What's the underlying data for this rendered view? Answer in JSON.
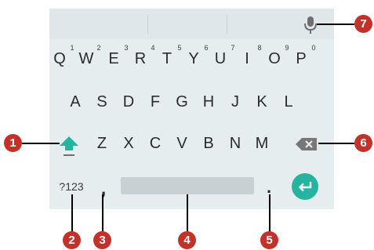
{
  "keyboard": {
    "row1": [
      {
        "letter": "Q",
        "num": "1"
      },
      {
        "letter": "W",
        "num": "2"
      },
      {
        "letter": "E",
        "num": "3"
      },
      {
        "letter": "R",
        "num": "4"
      },
      {
        "letter": "T",
        "num": "5"
      },
      {
        "letter": "Y",
        "num": "6"
      },
      {
        "letter": "U",
        "num": "7"
      },
      {
        "letter": "I",
        "num": "8"
      },
      {
        "letter": "O",
        "num": "9"
      },
      {
        "letter": "P",
        "num": "0"
      }
    ],
    "row2": [
      "A",
      "S",
      "D",
      "F",
      "G",
      "H",
      "J",
      "K",
      "L"
    ],
    "row3": [
      "Z",
      "X",
      "C",
      "V",
      "B",
      "N",
      "M"
    ],
    "symbols_key": "?123",
    "comma_key": ",",
    "period_key": "."
  },
  "callouts": [
    "1",
    "2",
    "3",
    "4",
    "5",
    "6",
    "7"
  ],
  "colors": {
    "keyboard_bg": "#e6edef",
    "suggestion_bg": "#e0e7ea",
    "accent": "#26b3a0",
    "callout": "#c3322a",
    "key_text": "#2b2b2b",
    "icon_gray": "#6f6f6f"
  },
  "icons": {
    "mic": "microphone-icon",
    "shift": "shift-icon",
    "backspace": "backspace-icon",
    "enter": "enter-icon"
  }
}
